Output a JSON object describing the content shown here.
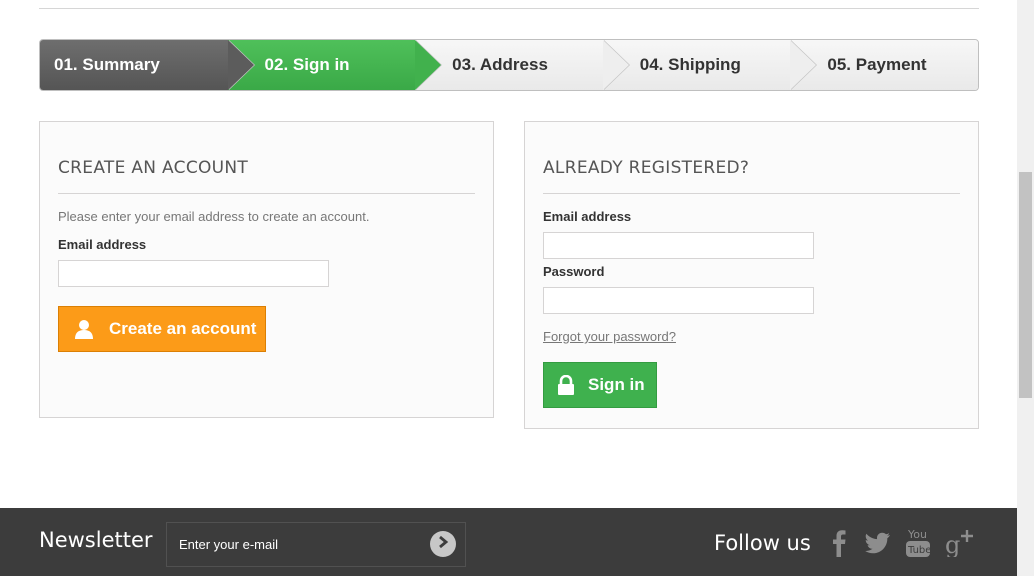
{
  "steps": [
    {
      "label": "01. Summary"
    },
    {
      "label": "02. Sign in"
    },
    {
      "label": "03. Address"
    },
    {
      "label": "04. Shipping"
    },
    {
      "label": "05. Payment"
    }
  ],
  "create_account": {
    "heading": "CREATE AN ACCOUNT",
    "hint": "Please enter your email address to create an account.",
    "email_label": "Email address",
    "email_value": "",
    "button_label": "Create an account"
  },
  "login": {
    "heading": "ALREADY REGISTERED?",
    "email_label": "Email address",
    "email_value": "",
    "password_label": "Password",
    "password_value": "",
    "forgot_label": "Forgot your password?",
    "button_label": "Sign in"
  },
  "footer": {
    "newsletter_title": "Newsletter",
    "newsletter_placeholder": "Enter your e-mail",
    "follow_title": "Follow us",
    "social": [
      "facebook-icon",
      "twitter-icon",
      "youtube-icon",
      "google-plus-icon"
    ]
  },
  "colors": {
    "active_step": "#41b14d",
    "done_step": "#5c5c5c",
    "create_button": "#fc9b18",
    "signin_button": "#3fb14e",
    "footer": "#3c3c3c"
  }
}
